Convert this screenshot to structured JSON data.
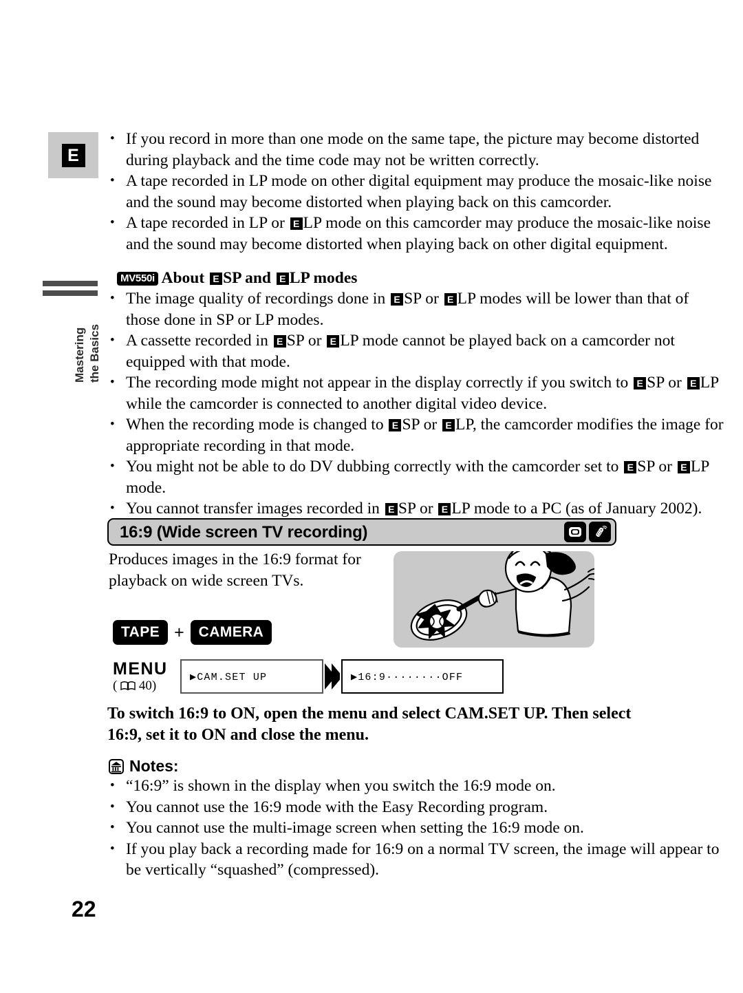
{
  "page": {
    "number": "22",
    "language_marker": "E",
    "side_tab": {
      "line1": "Mastering",
      "line2": "the Basics"
    }
  },
  "top_notes": {
    "items": [
      "If you record in more than one mode on the same tape, the picture may become distorted during playback and the time code may not be written correctly.",
      "A tape recorded in LP mode on other digital equipment may produce the mosaic-like noise and the sound may become distorted when playing back on this camcorder.",
      "A tape recorded in LP or ⓔLP mode on this camcorder may produce the mosaic-like noise and the sound may become distorted when playing back on other digital equipment."
    ]
  },
  "subsection": {
    "model_badge": "MV550i",
    "title_parts": {
      "about": "About",
      "sp": "SP and",
      "lp": "LP modes"
    },
    "chip_label": "E",
    "items": [
      "The image quality of recordings done in ⓔSP or ⓔLP modes will be lower than that of those done in SP or LP modes.",
      "A cassette recorded in ⓔSP or ⓔLP mode cannot be played back on a camcorder not equipped with that mode.",
      "The recording mode might not appear in the display correctly if you switch to ⓔSP or ⓔLP while the camcorder is connected to another digital video device.",
      "When the recording mode is changed to ⓔSP or ⓔLP, the camcorder modifies the image for appropriate recording in that mode.",
      "You might not be able to do DV dubbing correctly with the camcorder set to ⓔSP or ⓔLP mode.",
      "You cannot transfer images recorded in ⓔSP or ⓔLP mode to a PC (as of January 2002)."
    ]
  },
  "section": {
    "header_title": "16:9 (Wide screen TV recording)",
    "icons": [
      "camcorder-icon",
      "remote-control-icon"
    ],
    "intro": "Produces images in the 16:9 format for playback on wide screen TVs.",
    "illustration": "girl-playing-tennis-illustration",
    "mode_buttons": {
      "left": "TAPE",
      "plus": "+",
      "right": "CAMERA"
    },
    "menu": {
      "label": "MENU",
      "reference_open": "(",
      "reference_page": "40",
      "reference_close": ")",
      "step1": "▶CAM.SET UP",
      "step2": "▶16:9········OFF"
    },
    "instruction": "To switch 16:9 to ON, open the menu and select CAM.SET UP. Then select 16:9, set it to ON and close the menu."
  },
  "notes": {
    "heading": "Notes:",
    "items": [
      "“16:9” is shown in the display when you switch the 16:9 mode on.",
      "You cannot use the 16:9 mode with the Easy Recording program.",
      "You cannot use the multi-image screen when setting the 16:9 mode on.",
      "If you play back a recording made for 16:9 on a normal TV screen, the image will appear to be vertically “squashed” (compressed)."
    ]
  },
  "colors": {
    "gray_block": "#c9c9c9",
    "side_bar": "#4d4d4d",
    "black": "#000000"
  }
}
